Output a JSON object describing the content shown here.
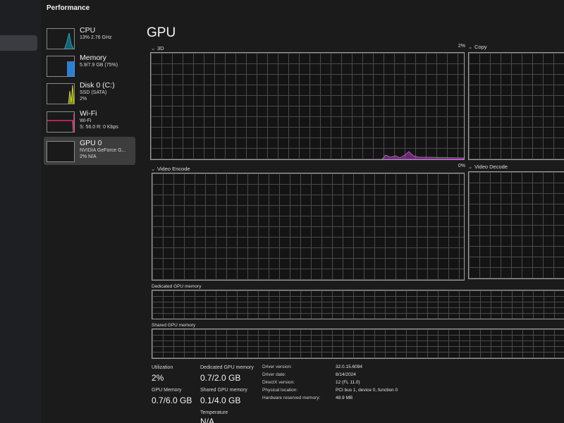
{
  "window": {
    "title": "Performance"
  },
  "devices": [
    {
      "name": "CPU",
      "line1": "13% 2.76 GHz",
      "line2": "",
      "color": "#17a8c8"
    },
    {
      "name": "Memory",
      "line1": "5.9/7.9 GB (75%)",
      "line2": "",
      "color": "#2a7fd6"
    },
    {
      "name": "Disk 0 (C:)",
      "line1": "SSD (SATA)",
      "line2": "2%",
      "color": "#8fb21c"
    },
    {
      "name": "Wi-Fi",
      "line1": "Wi-Fi",
      "line2": "S: 56.0 R: 0 Kbps",
      "color": "#c33a6e"
    },
    {
      "name": "GPU 0",
      "line1": "NVIDIA GeForce G...",
      "line2": "2% N/A",
      "color": "#b24ac9"
    }
  ],
  "gpu": {
    "title": "GPU",
    "engines": {
      "e3d": {
        "label": "3D",
        "pct": "2%"
      },
      "copy": {
        "label": "Copy"
      },
      "encode": {
        "label": "Video Encode",
        "pct": "0%"
      },
      "decode": {
        "label": "Video Decode"
      }
    },
    "dedicated_label": "Dedicated GPU memory",
    "shared_label": "Shared GPU memory",
    "graph_color": "#c54ad8",
    "stats": {
      "utilization_label": "Utilization",
      "utilization": "2%",
      "gpu_memory_label": "GPU Memory",
      "gpu_memory": "0.7/6.0 GB",
      "dedicated_label": "Dedicated GPU memory",
      "dedicated": "0.7/2.0 GB",
      "shared_label": "Shared GPU memory",
      "shared": "0.1/4.0 GB",
      "temperature_label": "Temperature",
      "temperature": "N/A"
    },
    "info": {
      "driver_version_label": "Driver version:",
      "driver_version": "32.0.15.6094",
      "driver_date_label": "Driver date:",
      "driver_date": "8/14/2024",
      "directx_label": "DirectX version:",
      "directx": "12 (FL 11.0)",
      "location_label": "Physical location:",
      "location": "PCI bus 1, device 0, function 0",
      "reserved_label": "Hardware reserved memory:",
      "reserved": "48.9 MB"
    }
  }
}
